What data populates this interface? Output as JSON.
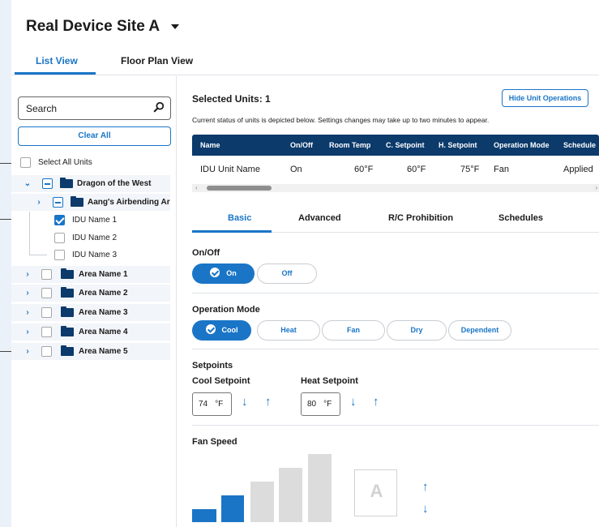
{
  "header": {
    "site_title": "Real Device Site A"
  },
  "view_tabs": [
    {
      "label": "List View",
      "active": true
    },
    {
      "label": "Floor Plan View",
      "active": false
    }
  ],
  "sidebar": {
    "search_placeholder": "Search",
    "clear_label": "Clear All",
    "select_all_label": "Select All Units",
    "tree": {
      "group": "Dragon of the West",
      "subgroup": "Aang's Airbending Ar",
      "units": [
        {
          "label": "IDU Name 1",
          "checked": true
        },
        {
          "label": "IDU Name 2",
          "checked": false
        },
        {
          "label": "IDU Name 3",
          "checked": false
        }
      ],
      "areas": [
        "Area Name 1",
        "Area Name 2",
        "Area Name 3",
        "Area Name 4",
        "Area Name 5"
      ]
    }
  },
  "main": {
    "selected_units": "Selected Units: 1",
    "hide_button": "Hide Unit Operations",
    "status_text": "Current status of units is depicted below. Settings changes may take up to two minutes to appear.",
    "table": {
      "headers": [
        "Name",
        "On/Off",
        "Room Temp",
        "C. Setpoint",
        "H. Setpoint",
        "Operation Mode",
        "Schedule"
      ],
      "row": [
        "IDU Unit Name",
        "On",
        "60°F",
        "60°F",
        "75°F",
        "Fan",
        "Applied"
      ]
    },
    "sub_tabs": [
      "Basic",
      "Advanced",
      "R/C Prohibition",
      "Schedules"
    ],
    "onoff": {
      "label": "On/Off",
      "on": "On",
      "off": "Off",
      "selected": "On"
    },
    "operation_mode": {
      "label": "Operation Mode",
      "options": [
        "Cool",
        "Heat",
        "Fan",
        "Dry",
        "Dependent"
      ],
      "selected": "Cool"
    },
    "setpoints": {
      "label": "Setpoints",
      "cool_label": "Cool Setpoint",
      "cool_value": "74",
      "cool_unit": "°F",
      "heat_label": "Heat Setpoint",
      "heat_value": "80",
      "heat_unit": "°F"
    },
    "fan_speed": {
      "label": "Fan Speed",
      "levels": 5,
      "selected_level": 2,
      "auto_label": "A"
    }
  },
  "colors": {
    "accent": "#1a75c7",
    "navy": "#0b3a6b",
    "background": "#eaf1f8"
  }
}
